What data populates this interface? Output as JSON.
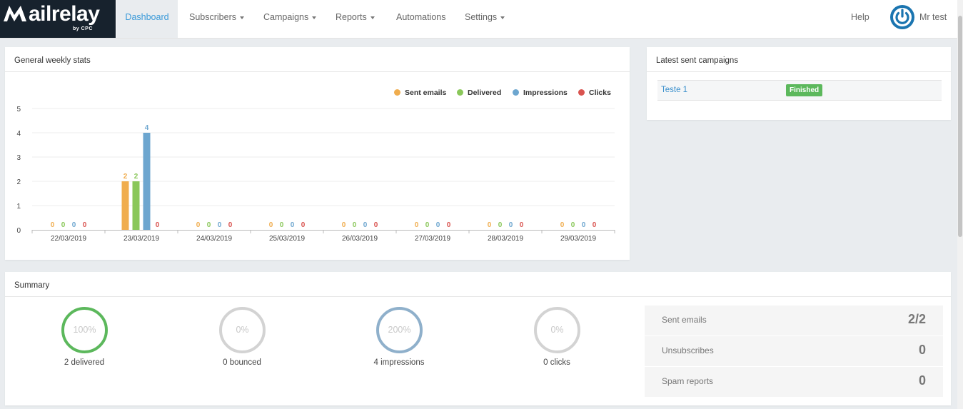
{
  "logo": {
    "text": "ailrelay",
    "by": "by CPC"
  },
  "nav": {
    "dashboard": "Dashboard",
    "subscribers": "Subscribers",
    "campaigns": "Campaigns",
    "reports": "Reports",
    "automations": "Automations",
    "settings": "Settings",
    "help": "Help",
    "user": "Mr test"
  },
  "colors": {
    "brand": "#17222d",
    "link": "#3a9ad9",
    "sent": "#f0ad4e",
    "delivered": "#8ac75a",
    "impressions": "#6da6cf",
    "clicks": "#d9534f",
    "finished": "#5cb85c"
  },
  "weekly": {
    "title": "General weekly stats"
  },
  "chart_data": {
    "type": "bar",
    "ylim": [
      0,
      5
    ],
    "yticks": [
      "0",
      "1",
      "2",
      "3",
      "4",
      "5"
    ],
    "categories": [
      "22/03/2019",
      "23/03/2019",
      "24/03/2019",
      "25/03/2019",
      "26/03/2019",
      "27/03/2019",
      "28/03/2019",
      "29/03/2019"
    ],
    "series": [
      {
        "name": "Sent emails",
        "color": "#f0ad4e",
        "values": [
          0,
          2,
          0,
          0,
          0,
          0,
          0,
          0
        ]
      },
      {
        "name": "Delivered",
        "color": "#8ac75a",
        "values": [
          0,
          2,
          0,
          0,
          0,
          0,
          0,
          0
        ]
      },
      {
        "name": "Impressions",
        "color": "#6da6cf",
        "values": [
          0,
          4,
          0,
          0,
          0,
          0,
          0,
          0
        ]
      },
      {
        "name": "Clicks",
        "color": "#d9534f",
        "values": [
          0,
          0,
          0,
          0,
          0,
          0,
          0,
          0
        ]
      }
    ],
    "legend_position": "top-right",
    "grid": true
  },
  "latest": {
    "title": "Latest sent campaigns",
    "campaign_name": "Teste 1",
    "status": "Finished"
  },
  "summary": {
    "title": "Summary",
    "rings": [
      {
        "pct": "100%",
        "label": "2 delivered",
        "color": "#5cb85c"
      },
      {
        "pct": "0%",
        "label": "0 bounced",
        "color": "#d3d3d3"
      },
      {
        "pct": "200%",
        "label": "4 impressions",
        "color": "#8fb0cb"
      },
      {
        "pct": "0%",
        "label": "0 clicks",
        "color": "#d3d3d3"
      }
    ],
    "stats": [
      {
        "label": "Sent emails",
        "value": "2/2"
      },
      {
        "label": "Unsubscribes",
        "value": "0"
      },
      {
        "label": "Spam reports",
        "value": "0"
      }
    ]
  }
}
